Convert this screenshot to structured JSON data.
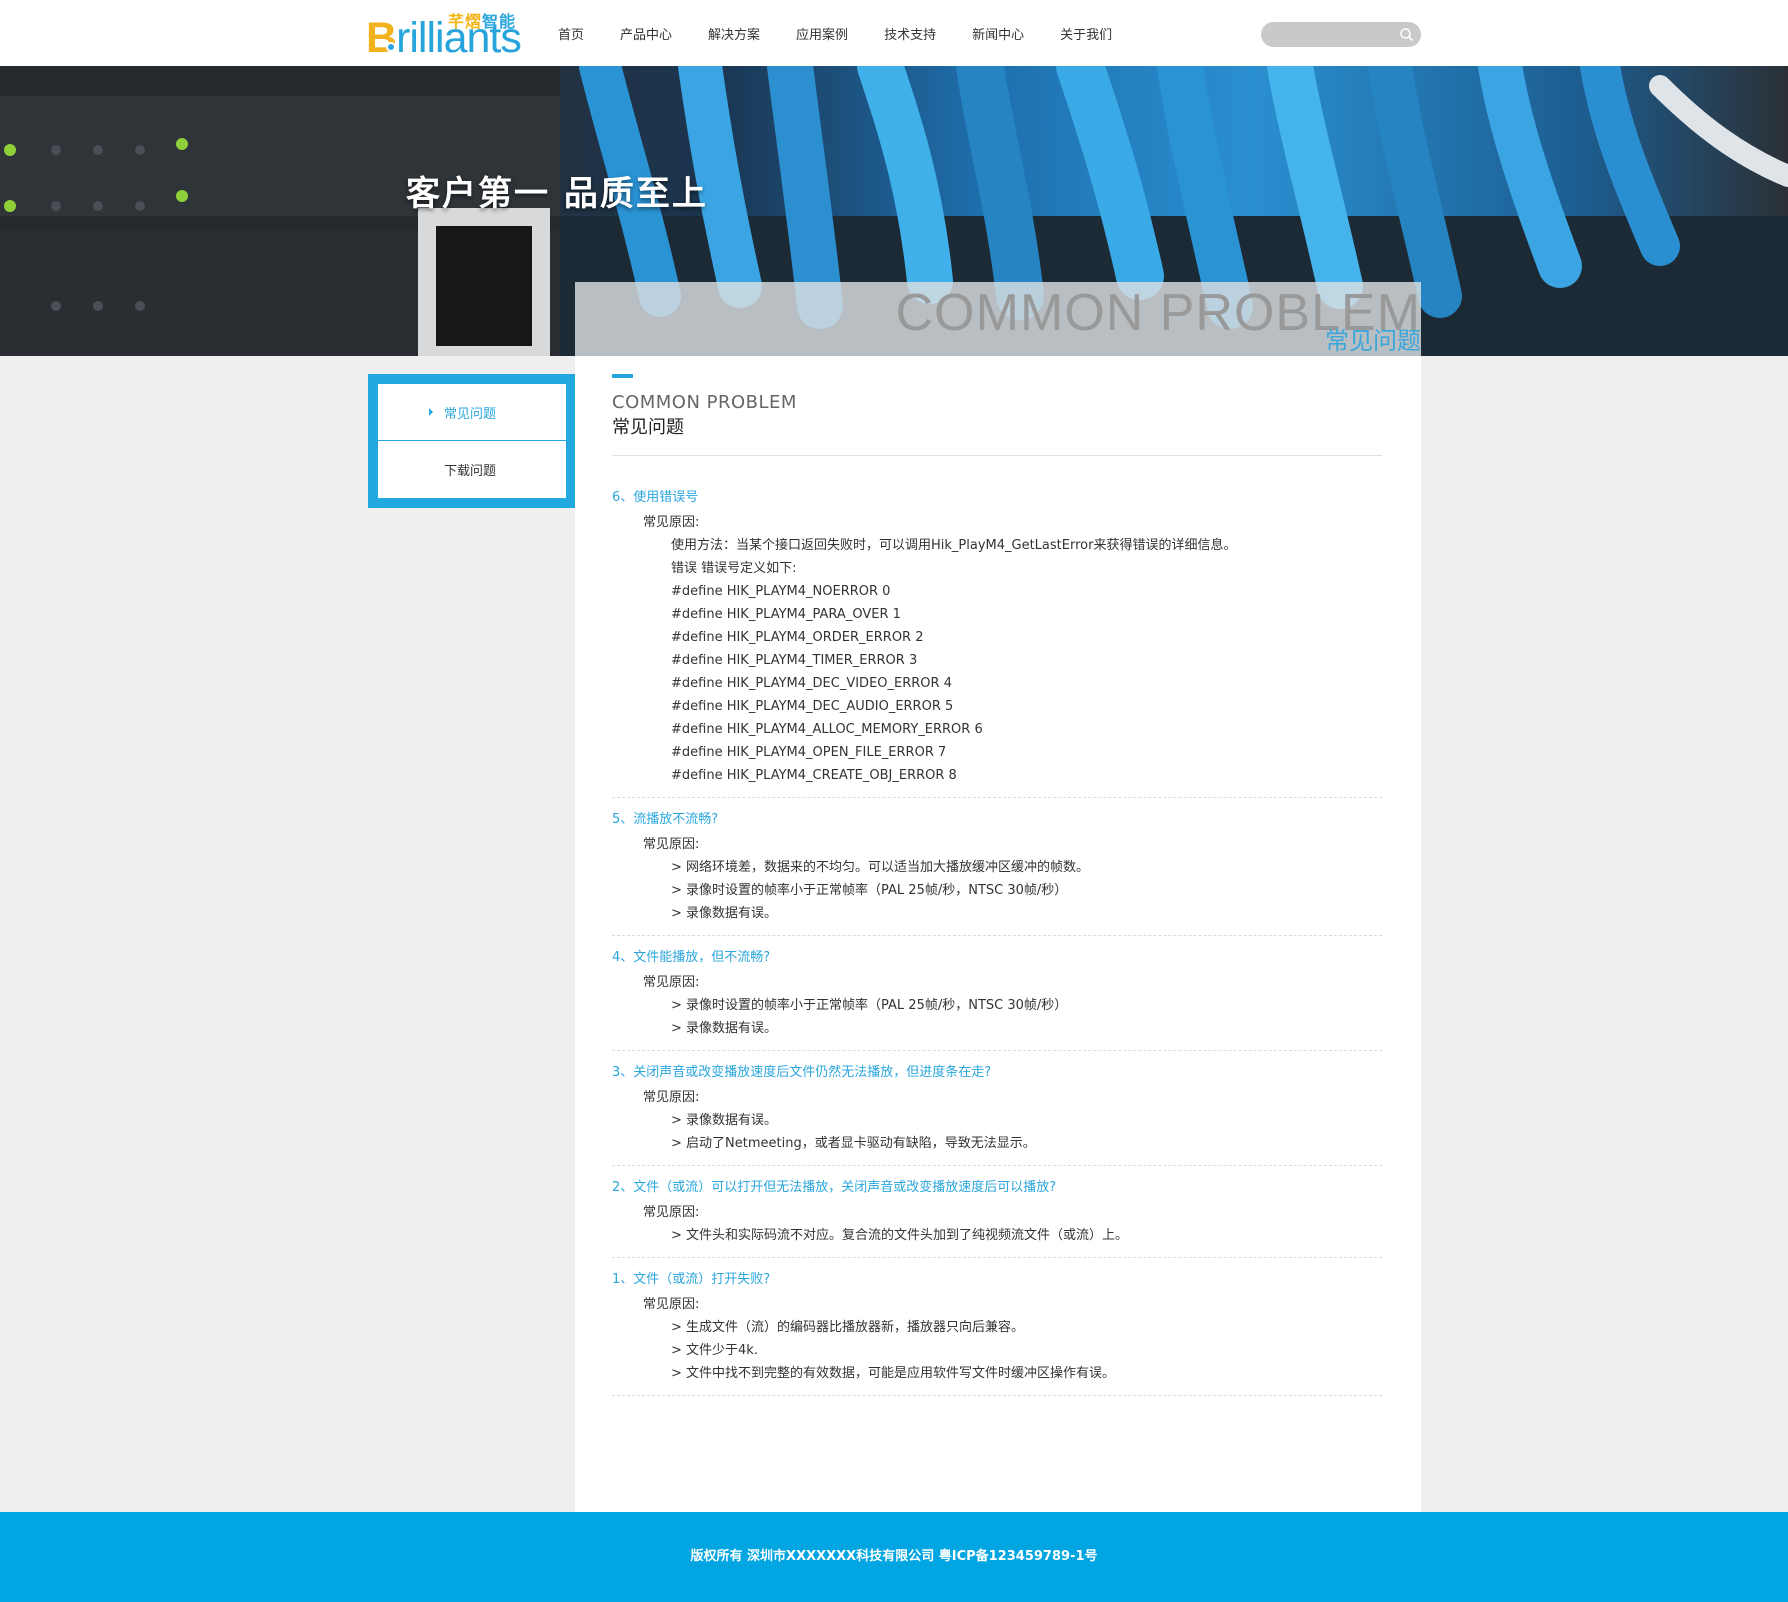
{
  "header": {
    "logo": {
      "cn_part1": "芊熠",
      "cn_part2": "智能",
      "en_initial": "B",
      "en_rest": "rilliants"
    },
    "nav": [
      "首页",
      "产品中心",
      "解决方案",
      "应用案例",
      "技术支持",
      "新闻中心",
      "关于我们"
    ],
    "search": {
      "placeholder": "",
      "icon": "search-icon"
    }
  },
  "banner": {
    "slogan": "客户第一  品质至上"
  },
  "page_title": {
    "en": "COMMON PROBLEM",
    "cn": "常见问题"
  },
  "sidebar": {
    "items": [
      {
        "label": "常见问题",
        "active": true
      },
      {
        "label": "下载问题",
        "active": false
      }
    ]
  },
  "section": {
    "title_en": "COMMON PROBLEM",
    "title_cn": "常见问题"
  },
  "faq": [
    {
      "question": "6、使用错误号",
      "reason_label": "常见原因:",
      "lines": [
        "使用方法：当某个接口返回失败时，可以调用Hik_PlayM4_GetLastError来获得错误的详细信息。",
        "错误 错误号定义如下:",
        "#define HIK_PLAYM4_NOERROR 0",
        "#define HIK_PLAYM4_PARA_OVER 1",
        "#define HIK_PLAYM4_ORDER_ERROR 2",
        "#define HIK_PLAYM4_TIMER_ERROR 3",
        "#define HIK_PLAYM4_DEC_VIDEO_ERROR 4",
        "#define HIK_PLAYM4_DEC_AUDIO_ERROR 5",
        "#define HIK_PLAYM4_ALLOC_MEMORY_ERROR 6",
        "#define HIK_PLAYM4_OPEN_FILE_ERROR 7",
        "#define HIK_PLAYM4_CREATE_OBJ_ERROR 8"
      ]
    },
    {
      "question": "5、流播放不流畅?",
      "reason_label": "常见原因:",
      "lines": [
        "> 网络环境差，数据来的不均匀。可以适当加大播放缓冲区缓冲的帧数。",
        "> 录像时设置的帧率小于正常帧率（PAL 25帧/秒，NTSC 30帧/秒）",
        "> 录像数据有误。"
      ]
    },
    {
      "question": "4、文件能播放，但不流畅?",
      "reason_label": "常见原因:",
      "lines": [
        "> 录像时设置的帧率小于正常帧率（PAL 25帧/秒，NTSC 30帧/秒）",
        "> 录像数据有误。"
      ]
    },
    {
      "question": "3、关闭声音或改变播放速度后文件仍然无法播放，但进度条在走?",
      "reason_label": "常见原因:",
      "lines": [
        "> 录像数据有误。",
        "> 启动了Netmeeting，或者显卡驱动有缺陷，导致无法显示。"
      ]
    },
    {
      "question": "2、文件（或流）可以打开但无法播放，关闭声音或改变播放速度后可以播放?",
      "reason_label": "常见原因:",
      "lines": [
        "> 文件头和实际码流不对应。复合流的文件头加到了纯视频流文件（或流）上。"
      ]
    },
    {
      "question": "1、文件（或流）打开失败?",
      "reason_label": "常见原因:",
      "lines": [
        "> 生成文件（流）的编码器比播放器新，播放器只向后兼容。",
        "> 文件少于4k.",
        "> 文件中找不到完整的有效数据，可能是应用软件写文件时缓冲区操作有误。"
      ]
    }
  ],
  "footer": {
    "copyright": "版权所有 深圳市XXXXXXX科技有限公司 粤ICP备123459789-1号"
  },
  "colors": {
    "accent": "#22a7de",
    "footer": "#00a5e1",
    "logo_yellow": "#f1b21e"
  }
}
